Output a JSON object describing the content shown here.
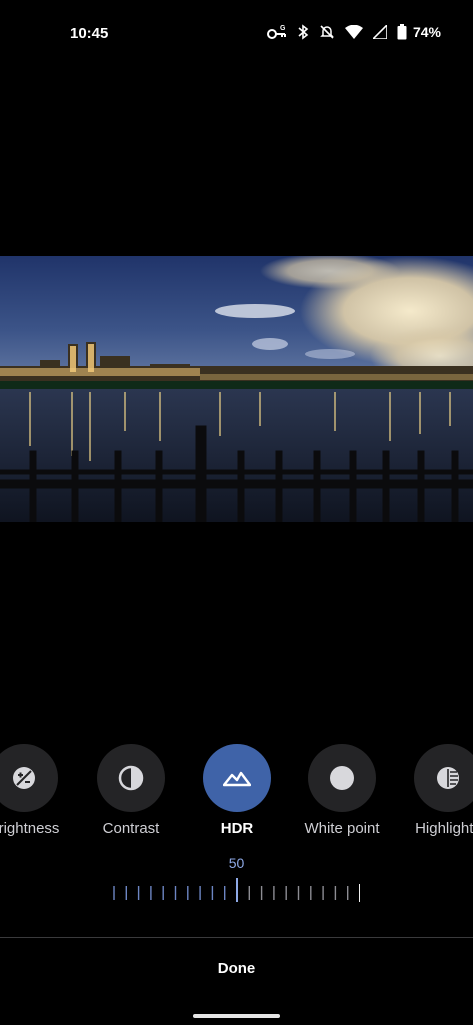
{
  "status_bar": {
    "time": "10:45",
    "battery_percent": "74%",
    "icons": [
      "vpn-key-icon",
      "bluetooth-icon",
      "mute-icon",
      "wifi-icon",
      "signal-icon",
      "battery-icon"
    ]
  },
  "photo": {
    "subject": "night-city-skyline-over-reservoir"
  },
  "tools": [
    {
      "label": "Brightness",
      "icon": "brightness-icon",
      "active": false
    },
    {
      "label": "Contrast",
      "icon": "contrast-icon",
      "active": false
    },
    {
      "label": "HDR",
      "icon": "hdr-mountain-icon",
      "active": true
    },
    {
      "label": "White point",
      "icon": "white-point-icon",
      "active": false
    },
    {
      "label": "Highlights",
      "icon": "highlights-icon",
      "active": false
    }
  ],
  "slider": {
    "value": "50",
    "min": 0,
    "max": 100
  },
  "footer": {
    "done_label": "Done"
  },
  "colors": {
    "accent": "#3f63a8",
    "accent_text": "#8ea9e6",
    "tool_background": "#242426"
  }
}
